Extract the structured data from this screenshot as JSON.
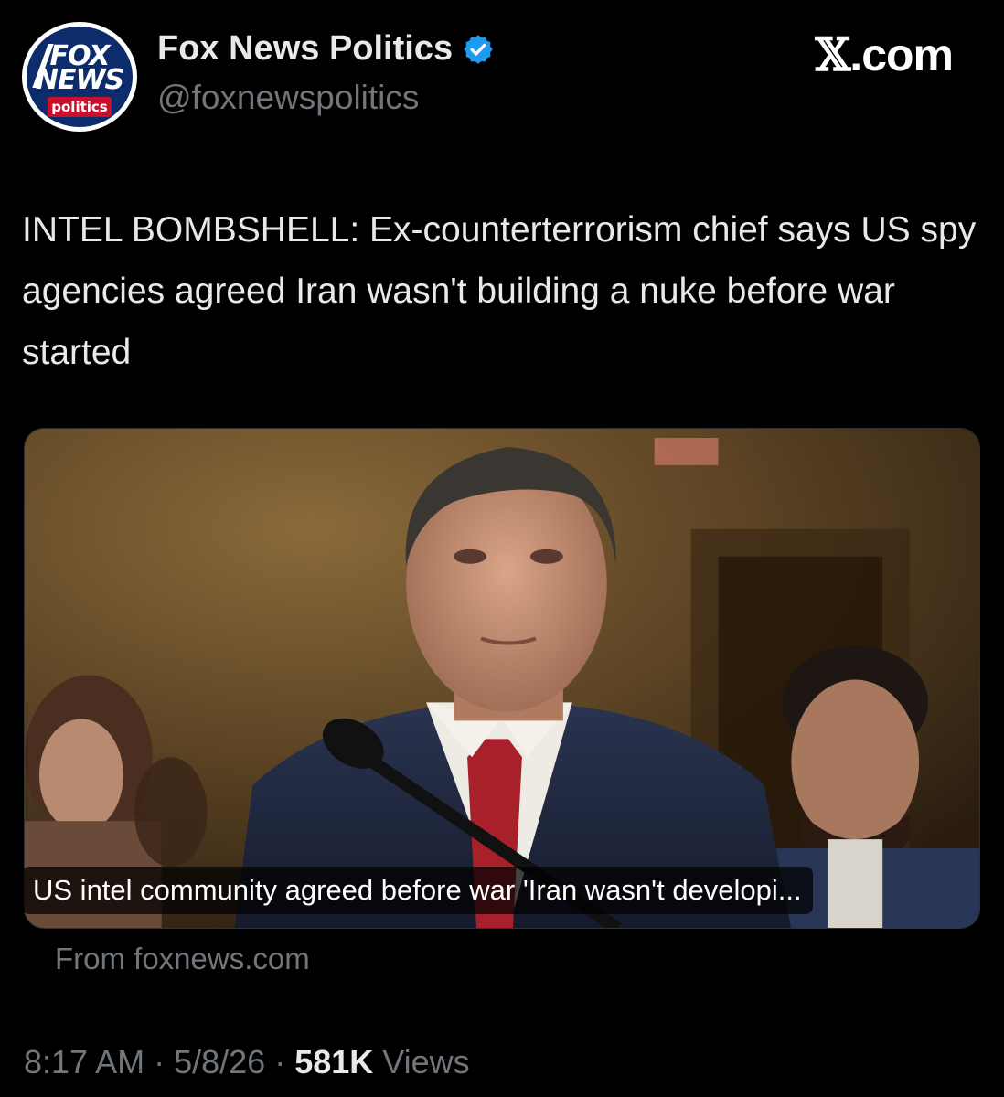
{
  "author": {
    "display_name": "Fox News Politics",
    "handle": "@foxnewspolitics",
    "verified_color": "#1d9bf0",
    "avatar_logo": {
      "line1": "FOX",
      "line2": "NEWS",
      "line3": "politics"
    }
  },
  "watermark": {
    "x_glyph": "𝕏",
    "suffix": ".com"
  },
  "post": {
    "text": "INTEL BOMBSHELL: Ex-counterterrorism chief says US spy agencies agreed Iran wasn't building a nuke before war started"
  },
  "link_card": {
    "caption": "US intel community agreed before war 'Iran wasn't developi...",
    "source": "From foxnews.com"
  },
  "meta": {
    "time": "8:17 AM",
    "sep1": " · ",
    "date": "5/8/26",
    "sep2": " · ",
    "views_count": "581K",
    "views_label": " Views"
  },
  "colors": {
    "background": "#000000",
    "secondary_text": "#71767b",
    "primary_text": "#e7e9ea",
    "tie_red": "#a8202a"
  }
}
